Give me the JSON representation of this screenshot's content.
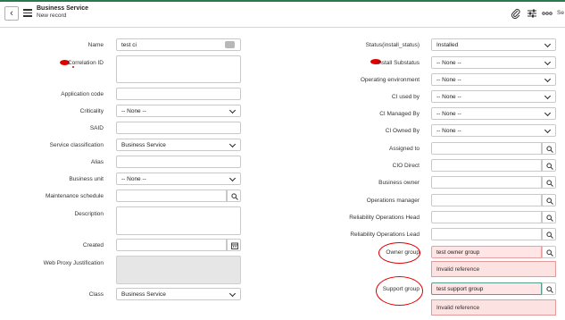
{
  "header": {
    "title": "Business Service",
    "subtitle": "New record",
    "truncated_action": "Se"
  },
  "left": {
    "name_label": "Name",
    "name_value": "test ci",
    "correlation_label": "Correlation ID",
    "app_code_label": "Application code",
    "criticality_label": "Criticality",
    "criticality_value": "-- None --",
    "said_label": "SAID",
    "service_class_label": "Service classification",
    "service_class_value": "Business Service",
    "alias_label": "Alias",
    "business_unit_label": "Business unit",
    "business_unit_value": "-- None --",
    "maint_label": "Maintenance schedule",
    "description_label": "Description",
    "created_label": "Created",
    "web_proxy_label": "Web Proxy Justification",
    "class_label": "Class",
    "class_value": "Business Service"
  },
  "right": {
    "status_label": "Status(install_status)",
    "status_value": "Installed",
    "install_sub_label": "Install Substatus",
    "install_sub_value": "-- None --",
    "ops_env_label": "Operating environment",
    "ops_env_value": "-- None --",
    "ci_used_label": "CI used by",
    "ci_used_value": "-- None --",
    "ci_managed_label": "CI Managed By",
    "ci_managed_value": "-- None --",
    "ci_owned_label": "CI Owned By",
    "ci_owned_value": "-- None --",
    "assigned_label": "Assigned to",
    "cio_label": "CIO Direct",
    "bus_owner_label": "Business owner",
    "ops_mgr_label": "Operations manager",
    "rel_head_label": "Reliability Operations Head",
    "rel_lead_label": "Reliability Operations Lead",
    "owner_group_label": "Owner group",
    "owner_group_value": "test owner group",
    "owner_group_error": "Invalid reference",
    "support_group_label": "Support group",
    "support_group_value": "test support group",
    "support_group_error": "Invalid reference"
  },
  "colors": {
    "error_bg": "#fde2e2",
    "error_border": "#e39a9a",
    "annotation": "#e00000",
    "accent": "#2a7a4f"
  }
}
